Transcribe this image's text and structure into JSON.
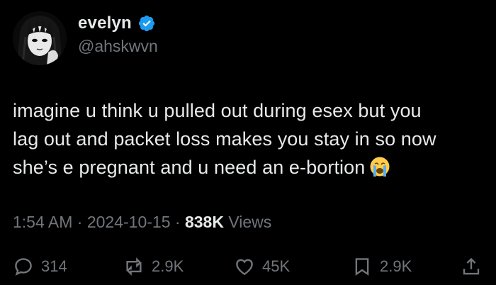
{
  "author": {
    "display_name": "evelyn",
    "handle": "@ahskwvn",
    "verified_icon": "verified-badge-icon",
    "verified_color": "#1d9bf0"
  },
  "tweet": {
    "lines": [
      "imagine u think u pulled out during esex but you",
      "lag out and packet loss makes you stay in so now",
      "she’s e pregnant and u need an e-bortion"
    ],
    "emoji": "loudly-crying-face-emoji"
  },
  "meta": {
    "time": "1:54 AM",
    "separator": "·",
    "date": "2024-10-15",
    "views_count": "838K",
    "views_label": "Views"
  },
  "actions": {
    "reply": {
      "icon": "reply-icon",
      "count": "314"
    },
    "repost": {
      "icon": "repost-icon",
      "count": "2.9K"
    },
    "like": {
      "icon": "heart-icon",
      "count": "45K"
    },
    "bookmark": {
      "icon": "bookmark-icon",
      "count": "2.9K"
    },
    "share": {
      "icon": "share-icon"
    }
  },
  "colors": {
    "background": "#000000",
    "primary_text": "#e7e9ea",
    "secondary_text": "#71767b"
  }
}
